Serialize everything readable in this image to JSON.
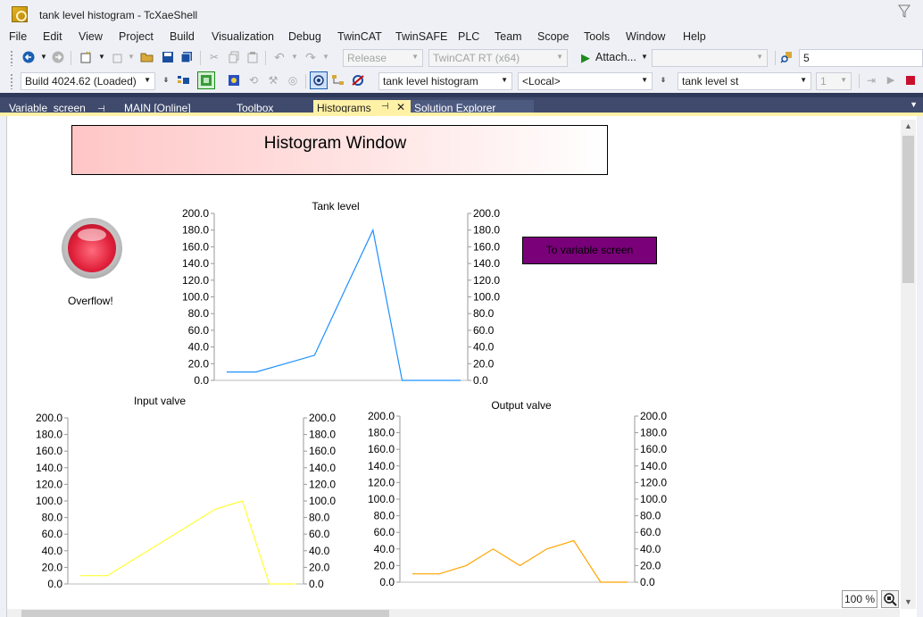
{
  "window": {
    "title": "tank level histogram - TcXaeShell",
    "app_icon": "twincat-app-icon"
  },
  "menu": [
    "File",
    "Edit",
    "View",
    "Project",
    "Build",
    "Visualization",
    "Debug",
    "TwinCAT",
    "TwinSAFE",
    "PLC",
    "Team",
    "Scope",
    "Tools",
    "Window",
    "Help"
  ],
  "toolbar1": {
    "config_value": "Release",
    "platform_value": "TwinCAT RT (x64)",
    "attach_label": "Attach...",
    "right_value": "5"
  },
  "toolbar2": {
    "build_value": "Build 4024.62 (Loaded)",
    "project_value": "tank level histogram",
    "target_value": "<Local>",
    "task_value": "tank level st",
    "number_value": "1"
  },
  "tabs": [
    {
      "label": "Variable_screen",
      "pinned": true
    },
    {
      "label": "MAIN [Online]"
    },
    {
      "label": "Toolbox"
    },
    {
      "label": "Histograms",
      "active": true
    },
    {
      "label": "Solution Explorer"
    }
  ],
  "content": {
    "banner_title": "Histogram Window",
    "overflow_label": "Overflow!",
    "button_label": "To variable screen",
    "zoom": "100 %"
  },
  "colors": {
    "tank": "#1e90ff",
    "input": "#ffff33",
    "output": "#ffa500",
    "button": "#7a007a",
    "tab_active": "#fff1a6"
  },
  "chart_data": [
    {
      "type": "line",
      "title": "Tank level",
      "x": [
        0,
        1,
        2,
        3,
        4,
        5,
        6,
        7,
        8
      ],
      "series": [
        {
          "values": [
            10,
            10,
            20,
            30,
            105,
            180,
            0,
            0,
            0
          ]
        }
      ],
      "ylim": [
        0,
        200
      ],
      "yticks": [
        "200.0",
        "180.0",
        "160.0",
        "140.0",
        "120.0",
        "100.0",
        "80.0",
        "60.0",
        "40.0",
        "20.0",
        "0.0"
      ],
      "color": "#1e90ff"
    },
    {
      "type": "line",
      "title": "Input valve",
      "x": [
        0,
        1,
        2,
        3,
        4,
        5,
        6,
        7,
        8
      ],
      "series": [
        {
          "values": [
            10,
            10,
            30,
            50,
            70,
            90,
            100,
            0,
            0
          ]
        }
      ],
      "ylim": [
        0,
        200
      ],
      "yticks": [
        "200.0",
        "180.0",
        "160.0",
        "140.0",
        "120.0",
        "100.0",
        "80.0",
        "60.0",
        "40.0",
        "20.0",
        "0.0"
      ],
      "color": "#ffff33"
    },
    {
      "type": "line",
      "title": "Output valve",
      "x": [
        0,
        1,
        2,
        3,
        4,
        5,
        6,
        7,
        8
      ],
      "series": [
        {
          "values": [
            10,
            10,
            20,
            40,
            20,
            40,
            50,
            0,
            0
          ]
        }
      ],
      "ylim": [
        0,
        200
      ],
      "yticks": [
        "200.0",
        "180.0",
        "160.0",
        "140.0",
        "120.0",
        "100.0",
        "80.0",
        "60.0",
        "40.0",
        "20.0",
        "0.0"
      ],
      "color": "#ffa500"
    }
  ]
}
